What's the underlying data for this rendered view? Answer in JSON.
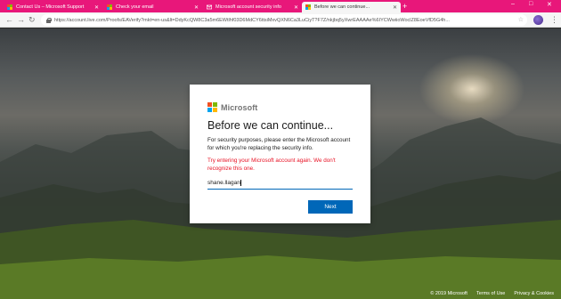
{
  "browser": {
    "tabs": [
      {
        "label": "Contact Us – Microsoft Support",
        "active": false
      },
      {
        "label": "Check your email",
        "active": false
      },
      {
        "label": "Microsoft account security info",
        "active": false
      },
      {
        "label": "Before we can continue...",
        "active": true
      }
    ],
    "new_tab_label": "+",
    "window_controls": {
      "minimize": "–",
      "maximize": "□",
      "close": "✕"
    },
    "url": "https://account.live.com/Proofs/EAVerify?mkt=en-us&lt=DdyKcQW8C3a5m6EWtlhf03D6MdCY6ttsiMxvQXN6Ca3LuCiyT?F7Z/nkjbq5yXwrEAAAAe%6IYCWwiioWoclZ8EoeVfD5G4h...",
    "accent": "#e8177a"
  },
  "card": {
    "brand": "Microsoft",
    "title": "Before we can continue...",
    "description": "For security purposes, please enter the Microsoft account for which you're replacing the security info.",
    "error": "Try entering your Microsoft account again. We don't recognize this one.",
    "input_value": "shane.llagan",
    "next_label": "Next",
    "logo_colors": [
      "#f25022",
      "#7fba00",
      "#00a4ef",
      "#ffb900"
    ]
  },
  "footer": {
    "copyright": "© 2019 Microsoft",
    "terms": "Terms of Use",
    "privacy": "Privacy & Cookies"
  }
}
